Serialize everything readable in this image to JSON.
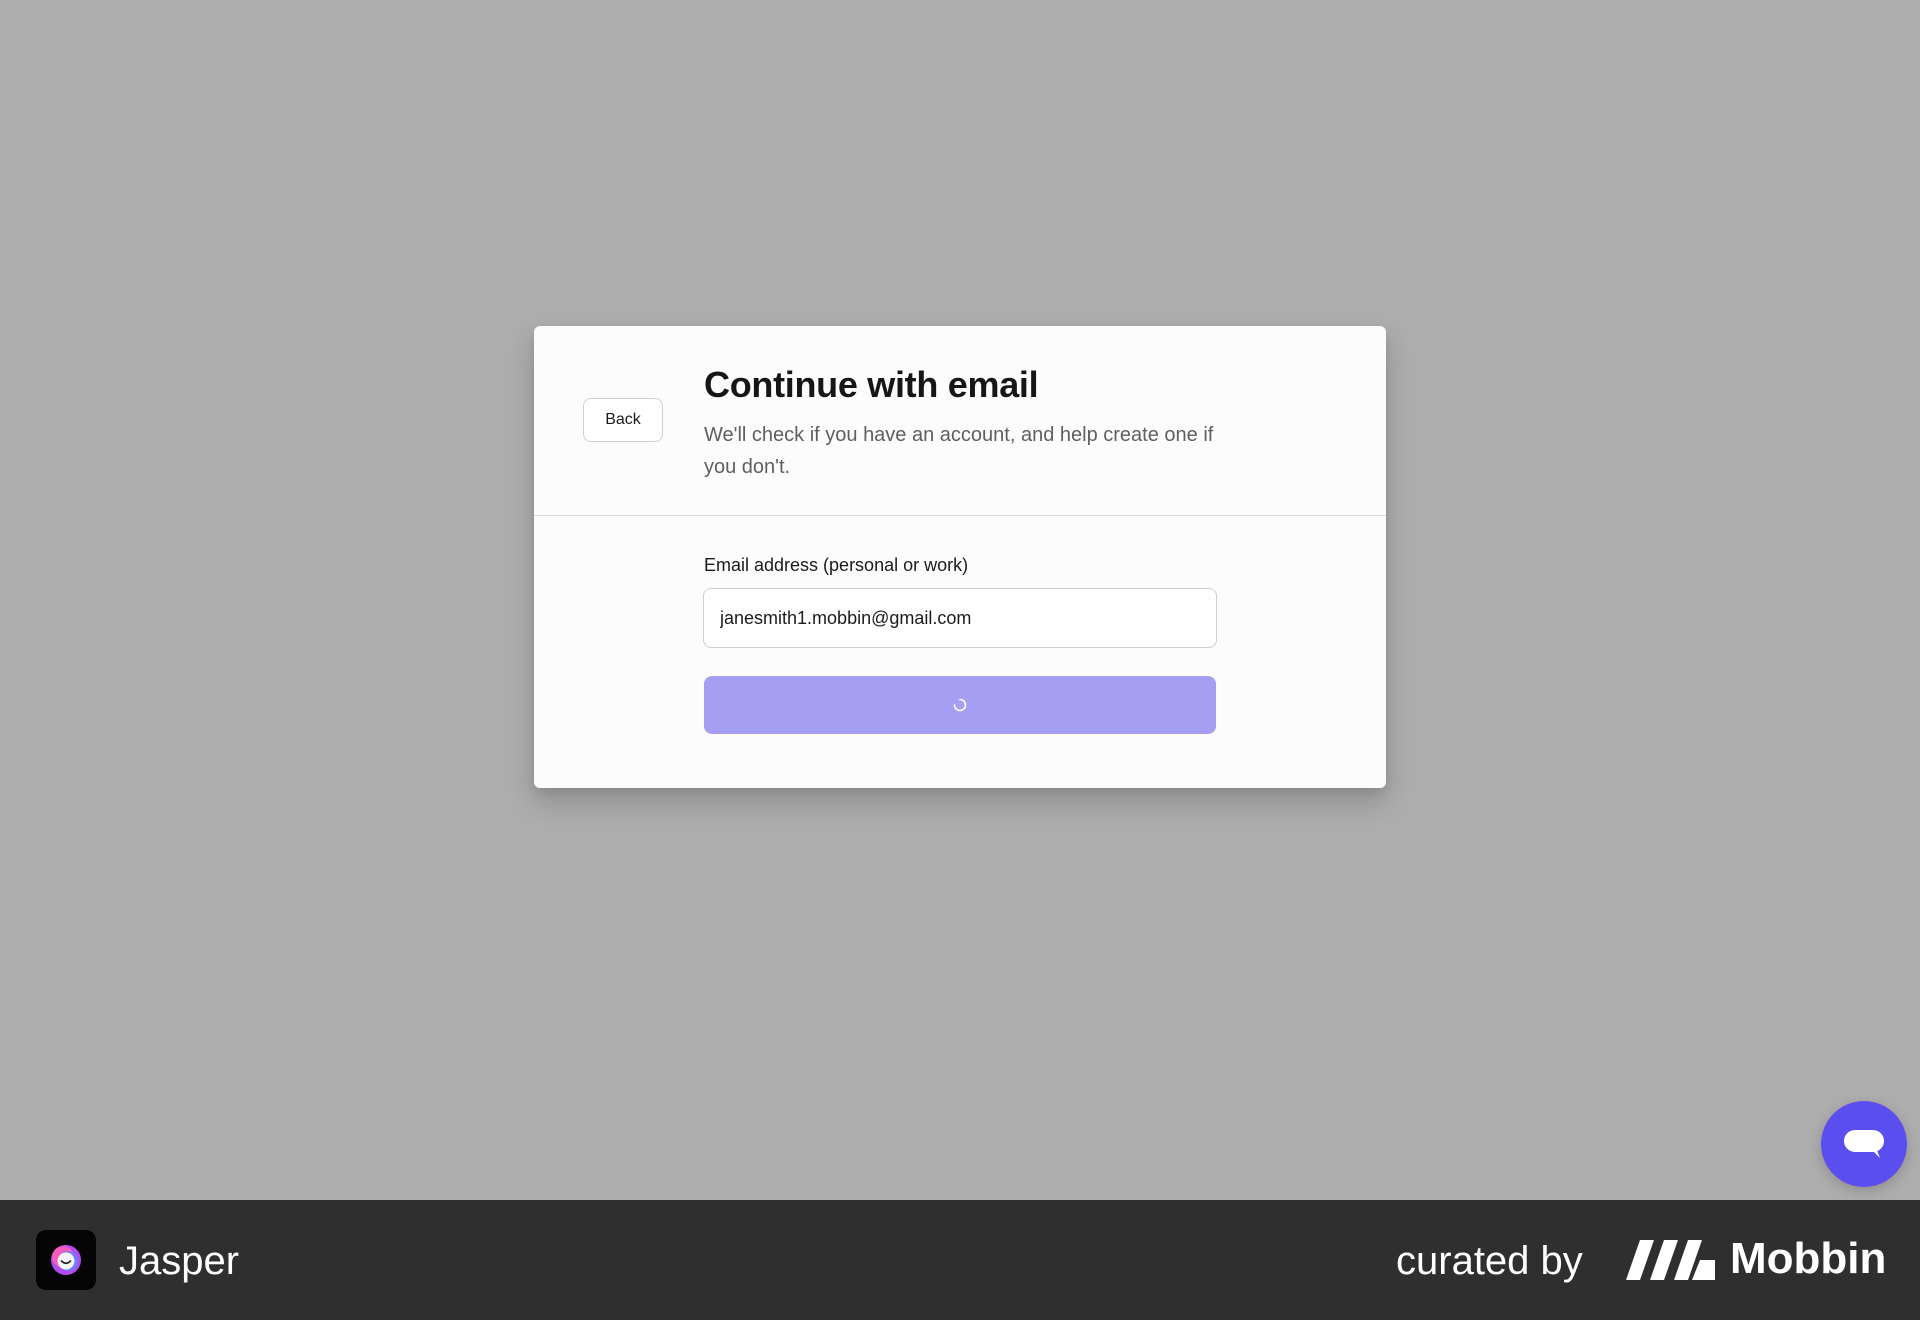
{
  "modal": {
    "back_label": "Back",
    "title": "Continue with email",
    "subtitle": "We'll check if you have an account, and help create one if you don't.",
    "email_label": "Email address (personal or work)",
    "email_value": "janesmith1.mobbin@gmail.com",
    "submit_state": "loading",
    "submit_icon": "spinner-icon"
  },
  "chat_widget": {
    "icon": "chat-bubble-icon"
  },
  "footer": {
    "app_name": "Jasper",
    "app_icon": "jasper-logo-icon",
    "curated_by": "curated by",
    "brand_name": "Mobbin",
    "brand_icon": "mobbin-logo-icon"
  },
  "colors": {
    "overlay": "#adadad",
    "modal_bg": "#fcfcfc",
    "button_loading": "#a59ff3",
    "chat_button": "#5b4ef0",
    "footer_bg": "#2f2f2f"
  }
}
